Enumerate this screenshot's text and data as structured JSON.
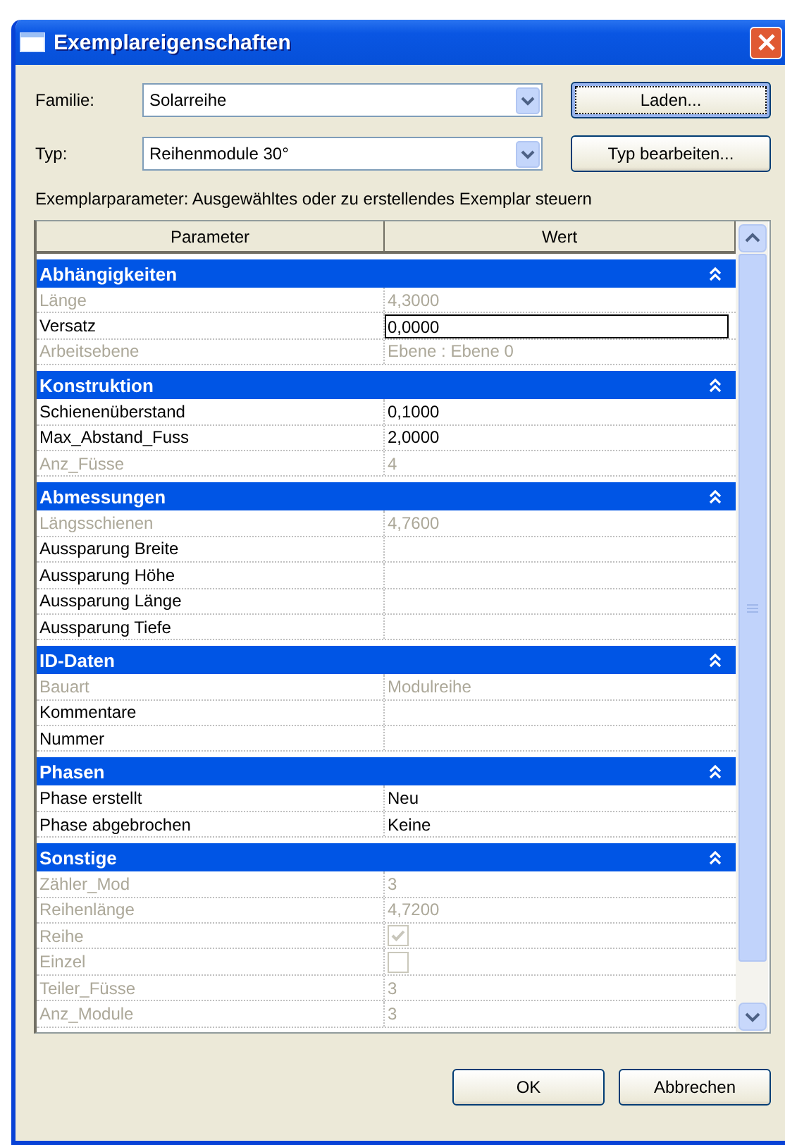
{
  "window": {
    "title": "Exemplareigenschaften"
  },
  "fields": [
    {
      "label": "Familie:",
      "value": "Solarreihe",
      "button": "Laden...",
      "button_focused": true
    },
    {
      "label": "Typ:",
      "value": "Reihenmodule 30°",
      "button": "Typ bearbeiten...",
      "button_focused": false
    }
  ],
  "description": "Exemplarparameter: Ausgewähltes oder zu erstellendes Exemplar steuern",
  "table": {
    "columns": [
      "Parameter",
      "Wert"
    ],
    "groups": [
      {
        "title": "Abhängigkeiten",
        "expanded": true,
        "rows": [
          {
            "kind": "value",
            "name": "Länge",
            "value": "4,3000",
            "disabled": true,
            "editing": false
          },
          {
            "kind": "value",
            "name": "Versatz",
            "value": "0,0000",
            "disabled": false,
            "editing": true
          },
          {
            "kind": "value",
            "name": "Arbeitsebene",
            "value": "Ebene : Ebene 0",
            "disabled": true,
            "editing": false
          }
        ]
      },
      {
        "title": "Konstruktion",
        "expanded": true,
        "rows": [
          {
            "kind": "value",
            "name": "Schienenüberstand",
            "value": "0,1000",
            "disabled": false,
            "editing": false
          },
          {
            "kind": "value",
            "name": "Max_Abstand_Fuss",
            "value": "2,0000",
            "disabled": false,
            "editing": false
          },
          {
            "kind": "value",
            "name": "Anz_Füsse",
            "value": "4",
            "disabled": true,
            "editing": false
          }
        ]
      },
      {
        "title": "Abmessungen",
        "expanded": true,
        "rows": [
          {
            "kind": "value",
            "name": "Längsschienen",
            "value": "4,7600",
            "disabled": true,
            "editing": false
          },
          {
            "kind": "value",
            "name": "Aussparung Breite",
            "disabled": false,
            "editing": false
          },
          {
            "kind": "value",
            "name": "Aussparung Höhe",
            "disabled": false,
            "editing": false
          },
          {
            "kind": "value",
            "name": "Aussparung Länge",
            "disabled": false,
            "editing": false
          },
          {
            "kind": "value",
            "name": "Aussparung Tiefe",
            "disabled": false,
            "editing": false
          }
        ]
      },
      {
        "title": "ID-Daten",
        "expanded": true,
        "rows": [
          {
            "kind": "value",
            "name": "Bauart",
            "value": "Modulreihe",
            "disabled": true,
            "editing": false
          },
          {
            "kind": "value",
            "name": "Kommentare",
            "disabled": false,
            "editing": false
          },
          {
            "kind": "value",
            "name": "Nummer",
            "disabled": false,
            "editing": false
          }
        ]
      },
      {
        "title": "Phasen",
        "expanded": true,
        "rows": [
          {
            "kind": "value",
            "name": "Phase erstellt",
            "value": "Neu",
            "disabled": false,
            "editing": false
          },
          {
            "kind": "value",
            "name": "Phase abgebrochen",
            "value": "Keine",
            "disabled": false,
            "editing": false
          }
        ]
      },
      {
        "title": "Sonstige",
        "expanded": true,
        "rows": [
          {
            "kind": "value",
            "name": "Zähler_Mod",
            "value": "3",
            "disabled": true,
            "editing": false
          },
          {
            "kind": "value",
            "name": "Reihenlänge",
            "value": "4,7200",
            "disabled": true,
            "editing": false
          },
          {
            "kind": "checkbox",
            "name": "Reihe",
            "checked": true,
            "disabled": true,
            "editing": false
          },
          {
            "kind": "checkbox",
            "name": "Einzel",
            "checked": false,
            "disabled": true,
            "editing": false
          },
          {
            "kind": "value",
            "name": "Teiler_Füsse",
            "value": "3",
            "disabled": true,
            "editing": false
          },
          {
            "kind": "value",
            "name": "Anz_Module",
            "value": "3",
            "disabled": true,
            "editing": false
          }
        ]
      }
    ]
  },
  "buttons": [
    "OK",
    "Abbrechen"
  ]
}
